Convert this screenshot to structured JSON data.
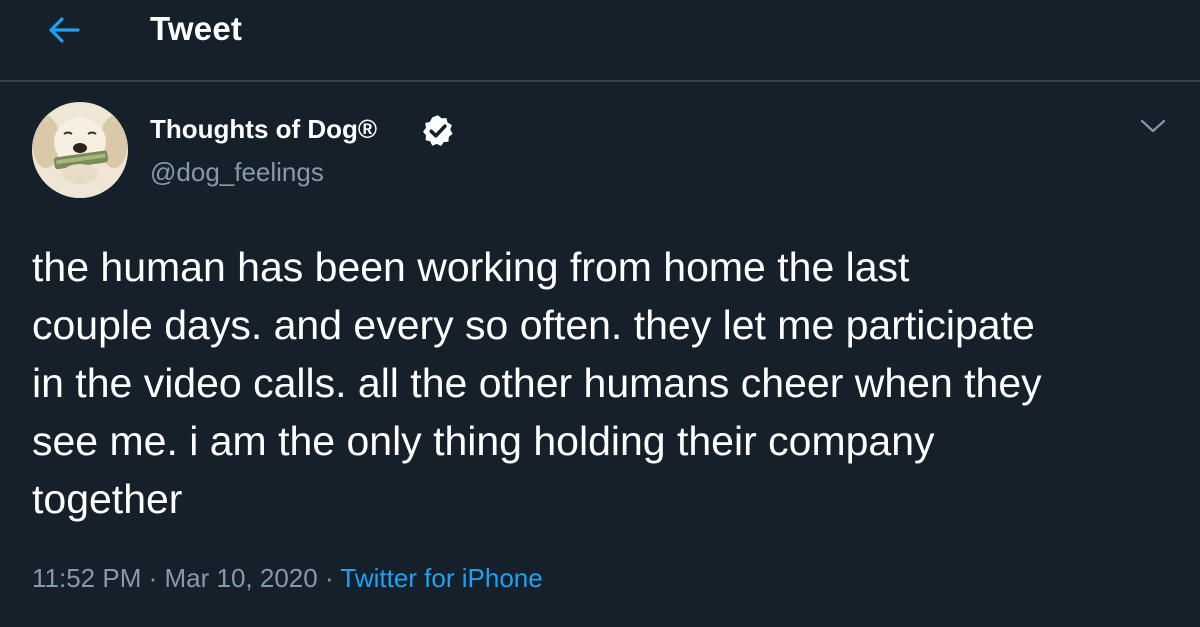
{
  "header": {
    "title": "Tweet",
    "back_icon": "arrow-left-icon"
  },
  "author": {
    "name": "Thoughts of Dog®",
    "handle": "@dog_feelings",
    "verified_icon": "verified-badge-icon",
    "avatar": "dog-avatar"
  },
  "tweet": {
    "text": "the human has been working from home the last\ncouple days. and every so often. they let me participate\nin the video calls. all the other humans cheer when they\nsee me. i am the only thing holding their company\ntogether",
    "time": "11:52 PM",
    "date": "Mar 10, 2020",
    "separator": "·",
    "source": "Twitter for iPhone",
    "more_icon": "chevron-down-icon"
  },
  "colors": {
    "background": "#15202b",
    "divider": "#38444d",
    "text_primary": "#ffffff",
    "text_secondary": "#8899a6",
    "accent": "#1da1f2"
  }
}
